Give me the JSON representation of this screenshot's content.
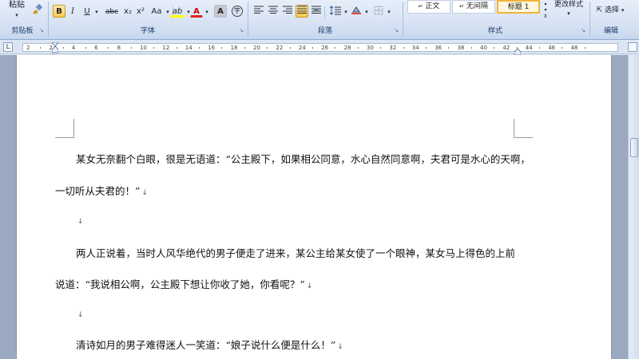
{
  "ribbon": {
    "clipboard": {
      "paste_label": "粘贴",
      "group_label": "剪贴板"
    },
    "font": {
      "group_label": "字体",
      "bold": "B",
      "italic": "I",
      "underline": "U",
      "strikethrough": "abc",
      "subscript": "x₂",
      "superscript": "x²",
      "change_case": "Aa",
      "highlight": "ab",
      "font_color": "A",
      "char_shading": "A",
      "enclose": "字"
    },
    "paragraph": {
      "group_label": "段落"
    },
    "styles": {
      "group_label": "样式",
      "items": [
        {
          "label": "正文",
          "prefix": "↵"
        },
        {
          "label": "无间隔",
          "prefix": "↵"
        },
        {
          "label": "标题 1",
          "prefix": ""
        }
      ],
      "change_styles": "更改样式"
    },
    "editing": {
      "select": "选择",
      "group_label": "编辑"
    },
    "accent": "#ffc84a"
  },
  "ruler": {
    "ticks": [
      "2",
      "2",
      "4",
      "6",
      "8",
      "10",
      "12",
      "14",
      "16",
      "18",
      "20",
      "22",
      "24",
      "26",
      "28",
      "30",
      "32",
      "34",
      "36",
      "38",
      "40",
      "42",
      "44",
      "46",
      "48"
    ]
  },
  "document": {
    "lines": [
      {
        "text": "某女无奈翻个白眼，很是无语道：“公主殿下，如果相公同意，水心自然同意啊，夫君可是水心的天啊，",
        "mark": ""
      },
      {
        "text": "一切听从夫君的！”",
        "mark": "↓"
      },
      {
        "text": "",
        "mark": "↓"
      },
      {
        "text": "两人正说着，当时人风华绝代的男子便走了进来，某公主给某女使了一个眼神，某女马上得色的上前",
        "mark": ""
      },
      {
        "text": "说道：“我说相公啊，公主殿下想让你收了她，你看呢？”",
        "mark": "↓"
      },
      {
        "text": "",
        "mark": "↓"
      },
      {
        "text": "清诗如月的男子难得迷人一笑道：“娘子说什么便是什么！”",
        "mark": "↓"
      }
    ]
  }
}
